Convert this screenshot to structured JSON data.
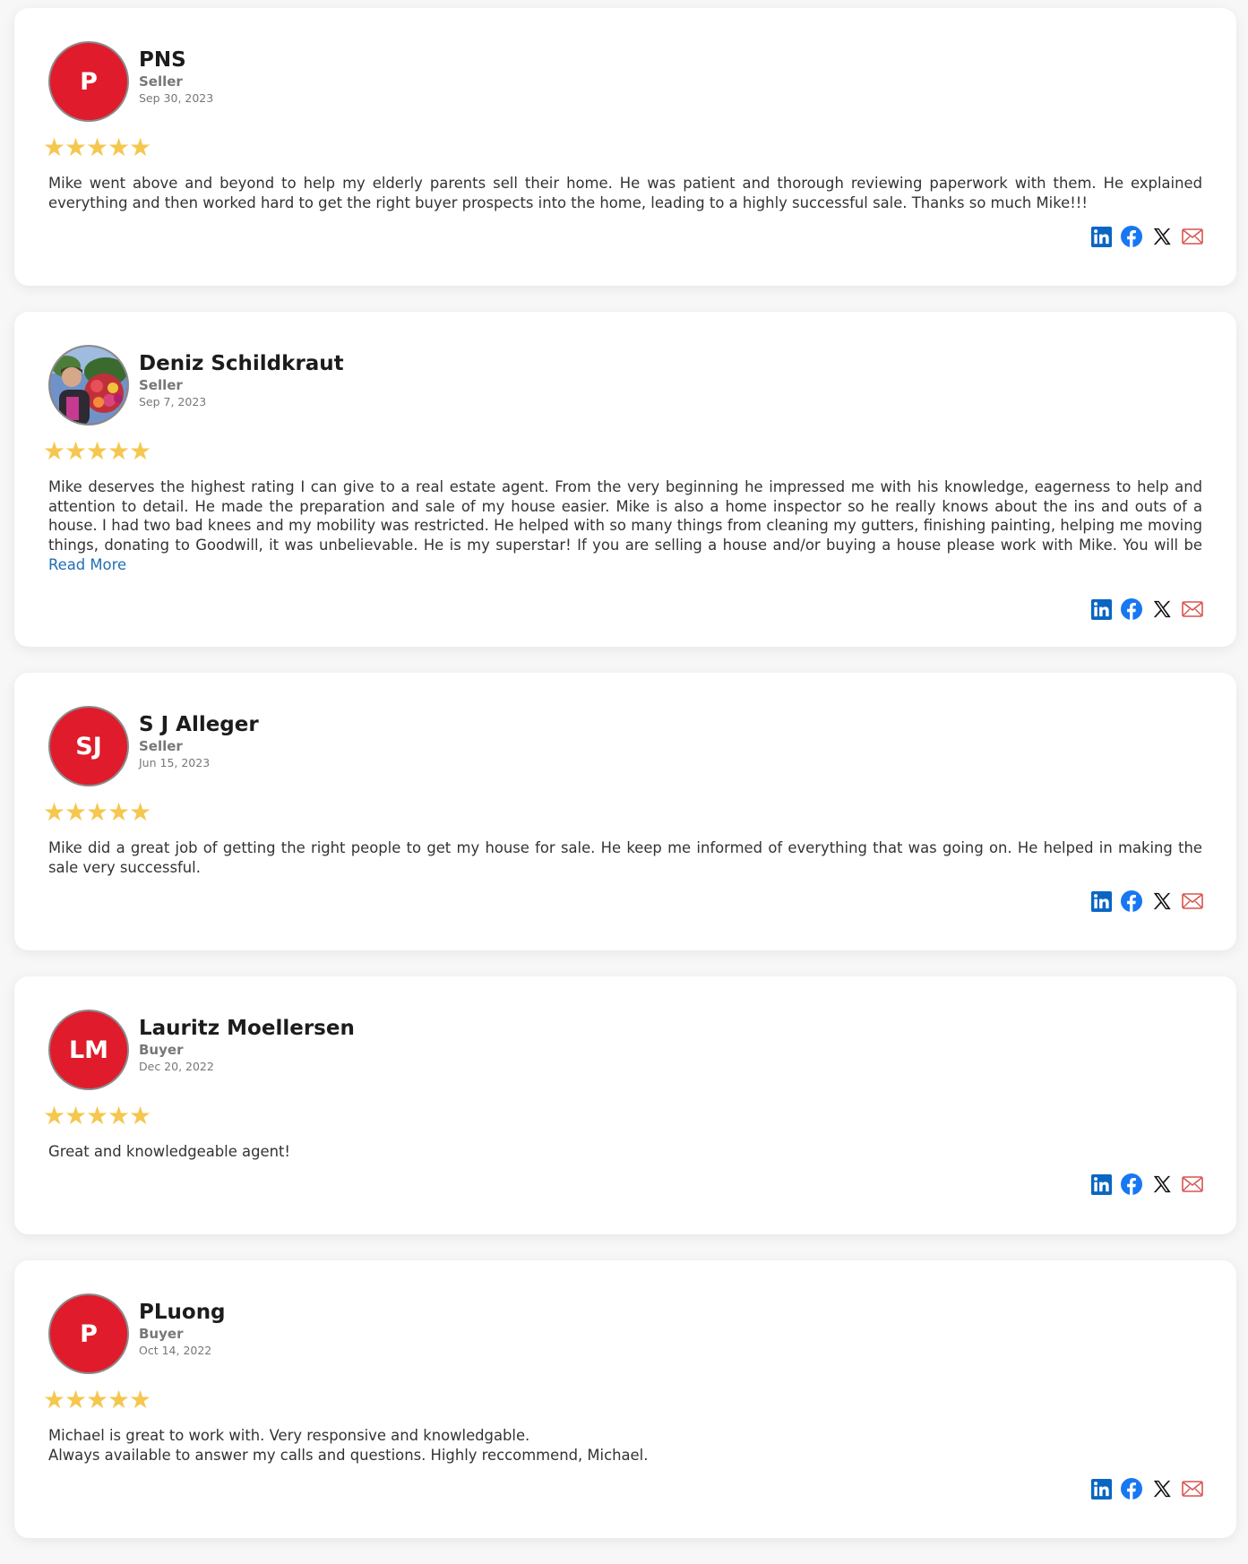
{
  "reviews": [
    {
      "initials": "P",
      "name": "PNS",
      "role": "Seller",
      "date": "Sep 30, 2023",
      "stars": 5,
      "text": "Mike went above and beyond to help my elderly parents sell their home. He was patient and thorough reviewing paperwork with them. He explained everything and then worked hard to get the right buyer prospects into the home, leading to a highly successful sale. Thanks so much Mike!!!"
    },
    {
      "initials": "",
      "name": "Deniz Schildkraut",
      "role": "Seller",
      "date": "Sep 7, 2023",
      "stars": 5,
      "text": "Mike deserves the highest rating I can give to a real estate agent. From the very beginning he impressed me with his knowledge, eagerness to help and attention to detail. He made the preparation and sale of my house easier. Mike is also a home inspector so he really knows about the ins and outs of a house. I had two bad knees and my mobility was restricted. He helped with so many things from cleaning my gutters, finishing painting, helping me moving things, donating to Goodwill, it was unbelievable. He is my superstar! If you are selling a house and/or buying a house please work with Mike. You will be impressed. Mike has my",
      "read_more": "Read More"
    },
    {
      "initials": "SJ",
      "name": "S J Alleger",
      "role": "Seller",
      "date": "Jun 15, 2023",
      "stars": 5,
      "text": "Mike did a great job of getting the right people to get my house for sale. He keep me informed of everything that was going on. He helped in making the sale very successful."
    },
    {
      "initials": "LM",
      "name": "Lauritz Moellersen",
      "role": "Buyer",
      "date": "Dec 20, 2022",
      "stars": 5,
      "text": "Great and knowledgeable agent!"
    },
    {
      "initials": "P",
      "name": "PLuong",
      "role": "Buyer",
      "date": "Oct 14, 2022",
      "stars": 5,
      "text_line1": "Michael is great to work with. Very responsive and knowledgable.",
      "text_line2": "Always available to answer my calls and questions. Highly reccommend, Michael."
    }
  ],
  "colors": {
    "avatar": "#e01b2b",
    "star": "#f5c74f",
    "link": "#1f6fb5",
    "linkedin": "#0a66c2",
    "facebook": "#1877f2",
    "x": "#111111",
    "email": "#d9534f"
  },
  "share_icons": [
    "linkedin-icon",
    "facebook-icon",
    "x-icon",
    "email-icon"
  ]
}
